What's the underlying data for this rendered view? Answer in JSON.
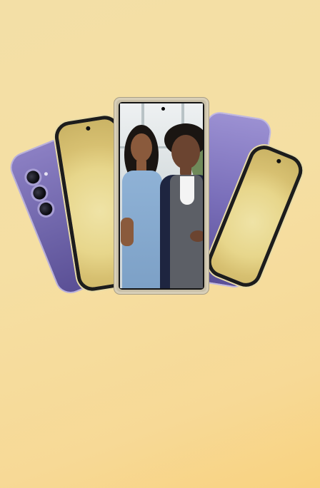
{
  "hero": {
    "background_colors": [
      "#f3dfa6",
      "#f8d27f"
    ],
    "image_alt": "",
    "phones": [
      {
        "icon": "phone-back-purple-icon",
        "color": "#7a6fba"
      },
      {
        "icon": "phone-front-gold-icon",
        "color": "#e7d68b"
      },
      {
        "icon": "phone-front-photo-icon",
        "color": "#c9c0a8"
      },
      {
        "icon": "phone-front-purple-icon",
        "color": "#7a6fba"
      },
      {
        "icon": "phone-front-gold-icon",
        "color": "#e7d68b"
      }
    ]
  }
}
